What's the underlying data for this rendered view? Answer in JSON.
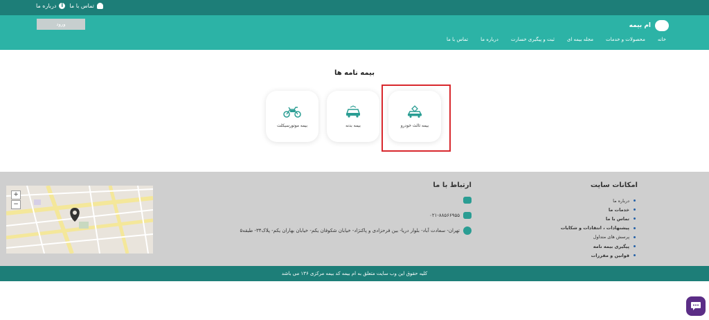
{
  "topbar": {
    "links": [
      {
        "label": "درباره ما",
        "icon": "info-icon"
      },
      {
        "label": "تماس با ما",
        "icon": "user-icon"
      }
    ]
  },
  "header": {
    "brand_logo_text": "",
    "brand_name": "ام بیمه",
    "login_label": "ورود",
    "nav": [
      "خانه",
      "محصولات و خدمات",
      "مجله بیمه ای",
      "ثبت و پیگیری خسارت",
      "درباره ما",
      "تماس با ما"
    ]
  },
  "main": {
    "section_title": "بیمه نامه ها",
    "cards": [
      {
        "label": "بیمه ثالث خودرو",
        "icon": "car-icon"
      },
      {
        "label": "بیمه بدنه",
        "icon": "car-body-icon"
      },
      {
        "label": "بیمه موتورسیکلت",
        "icon": "motorcycle-icon"
      }
    ]
  },
  "footer": {
    "contact_title": "ارتباط با ما",
    "phone": "۰۲۱-۸۸۵۶۶۹۵۵",
    "address": "تهران- سعادت آباد- بلوار دریا- بین فرحزادی و پاکنژاد- خیابان شکوفان یکم- خیابان بهاران یکم- پلاک۳۴- طبقه۵",
    "features_title": "امکانات سایت",
    "features": [
      {
        "label": "درباره ما",
        "bold": false
      },
      {
        "label": "خدمات ما",
        "bold": true
      },
      {
        "label": "تماس با ما",
        "bold": true
      },
      {
        "label": "پیشنهادات ، انتقادات و شکایات",
        "bold": true
      },
      {
        "label": "پرسش های متداول",
        "bold": false
      },
      {
        "label": "پیگیری بیمه نامه",
        "bold": true
      },
      {
        "label": "قوانین و مقررات",
        "bold": true
      }
    ],
    "map_zoom_in": "+",
    "map_zoom_out": "−"
  },
  "copyright": "کلیه حقوق این وب سایت متعلق به ام بیمه کد بیمه مرکزی ۱۳۶ می باشد",
  "colors": {
    "topbar": "#1d7e78",
    "header": "#2cb3a6",
    "footer": "#cfcfcf",
    "highlight": "#d8272c",
    "chat": "#5b2d86"
  }
}
